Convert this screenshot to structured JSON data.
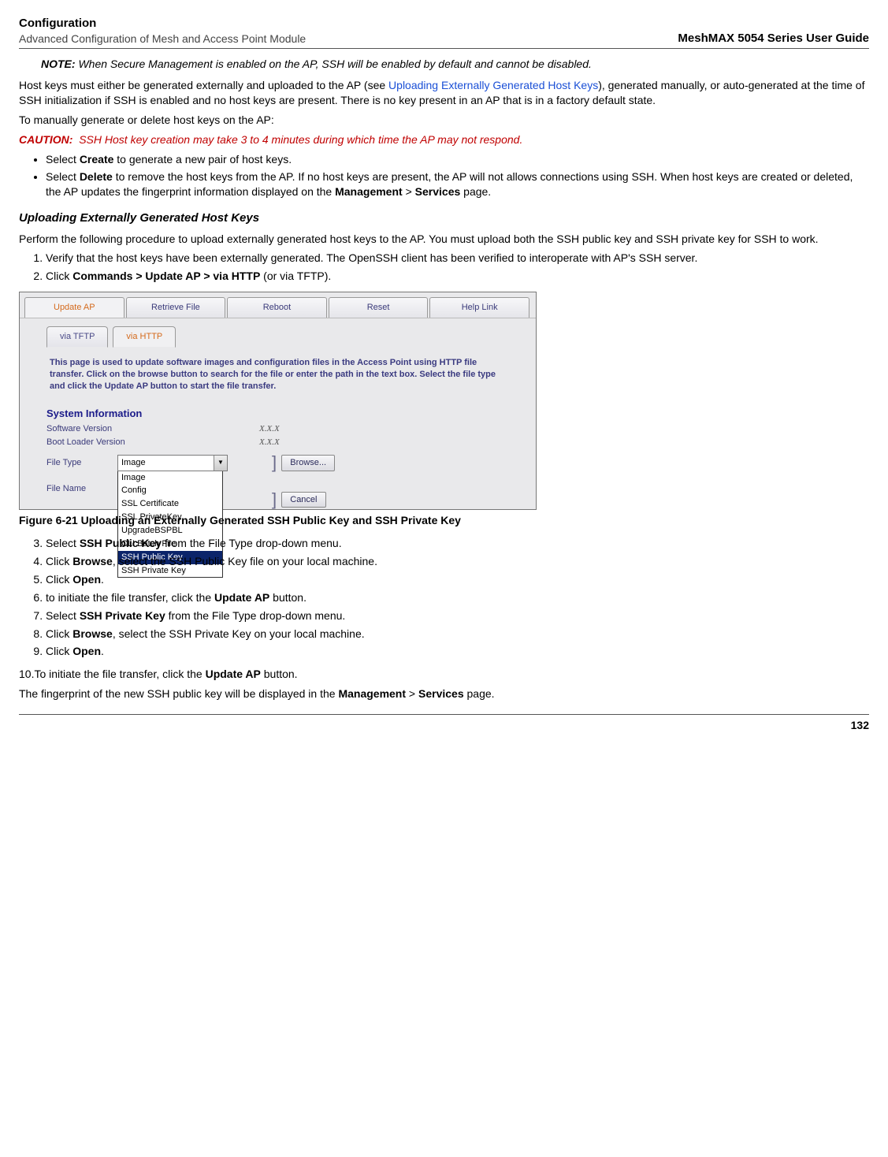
{
  "header": {
    "left_top": "Configuration",
    "left_sub": "Advanced Configuration of Mesh and Access Point Module",
    "right": "MeshMAX 5054 Series User Guide"
  },
  "note": {
    "prefix": "NOTE:",
    "body": "When Secure Management is enabled on the AP, SSH will be enabled by default and cannot be disabled."
  },
  "para_hostkeys_a": "Host keys must either be generated externally and uploaded to the AP (see ",
  "para_hostkeys_link": "Uploading Externally Generated Host Keys",
  "para_hostkeys_b": "), generated manually, or auto-generated at the time of SSH initialization if SSH is enabled and no host keys are present. There is no key present in an AP that is in a factory default state.",
  "para_manual": "To manually generate or delete host keys on the AP:",
  "caution": {
    "prefix": "CAUTION:",
    "body": "SSH Host key creation may take 3 to 4 minutes during which time the AP may not respond."
  },
  "bullets": {
    "b0_a": "Select ",
    "b0_bold": "Create",
    "b0_b": " to generate a new pair of host keys.",
    "b1_a": "Select ",
    "b1_bold1": "Delete",
    "b1_b": " to remove the host keys from the AP. If no host keys are present, the AP will not allows connections using SSH. When host keys are created or deleted, the AP updates the fingerprint information displayed on the ",
    "b1_bold2": "Management",
    "b1_gt": " > ",
    "b1_bold3": "Services",
    "b1_c": " page."
  },
  "section_head": "Uploading Externally Generated Host Keys",
  "para_perform": "Perform the following procedure to upload externally generated host keys to the AP. You must upload both the SSH public key and SSH private key for SSH to work.",
  "steps1": {
    "s1": "Verify that the host keys have been externally generated. The OpenSSH client has been verified to interoperate with AP's SSH server.",
    "s2_a": "Click ",
    "s2_bold": "Commands > Update AP > via HTTP",
    "s2_b": " (or via TFTP)."
  },
  "fig": {
    "top_tabs": [
      "Update AP",
      "Retrieve File",
      "Reboot",
      "Reset",
      "Help Link"
    ],
    "sub_tabs": [
      "via TFTP",
      "via HTTP"
    ],
    "blurb": "This page is used to update software images and configuration files in the Access Point using HTTP file transfer. Click on the browse button to search for the file or enter the path in the text box. Select the file type and click the Update AP button to start the file transfer.",
    "sysinfo_title": "System Information",
    "sw_label": "Software Version",
    "bl_label": "Boot Loader Version",
    "xxx": "X.X.X",
    "ft_label": "File Type",
    "fn_label": "File Name",
    "select_val": "Image",
    "options": [
      "Image",
      "Config",
      "SSL Certificate",
      "SSL PrivateKey",
      "UpgradeBSPBL",
      "CLI Batch File",
      "SSH Public Key",
      "SSH Private Key"
    ],
    "browse": "Browse...",
    "cancel": "Cancel"
  },
  "fig_caption": "Figure 6-21 Uploading an Externally Generated SSH Public Key and SSH Private Key",
  "steps2": {
    "s3_a": "Select ",
    "s3_bold": "SSH Public Key",
    "s3_b": " from the File Type drop-down menu.",
    "s4_a": "Click ",
    "s4_bold": "Browse",
    "s4_b": ", select the SSH Public Key file on your local machine.",
    "s5_a": "Click ",
    "s5_bold": "Open",
    "s5_b": ".",
    "s6_a": "to initiate the file transfer, click the ",
    "s6_bold": "Update AP",
    "s6_b": " button.",
    "s7_a": "Select ",
    "s7_bold": "SSH Private Key",
    "s7_b": " from the File Type drop-down menu.",
    "s8_a": "Click ",
    "s8_bold": "Browse",
    "s8_b": ", select the SSH Private Key on your local machine.",
    "s9_a": "Click ",
    "s9_bold": "Open",
    "s9_b": "."
  },
  "step10": {
    "a": "10.To initiate the file transfer, click the ",
    "bold": "Update AP",
    "b": " button."
  },
  "fingerprint": {
    "a": "The fingerprint of the new SSH public key will be displayed in the ",
    "b1": "Management",
    "gt": " > ",
    "b2": "Services",
    "c": " page."
  },
  "page_number": "132"
}
